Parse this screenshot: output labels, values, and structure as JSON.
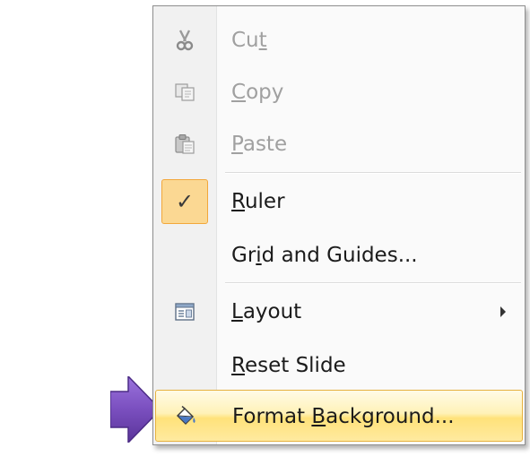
{
  "context_menu": {
    "items": [
      {
        "id": "cut",
        "parts": [
          "Cu",
          "t",
          ""
        ],
        "enabled": false,
        "icon": "scissors-icon"
      },
      {
        "id": "copy",
        "parts": [
          "",
          "C",
          "opy"
        ],
        "enabled": false,
        "icon": "copy-icon"
      },
      {
        "id": "paste",
        "parts": [
          "",
          "P",
          "aste"
        ],
        "enabled": false,
        "icon": "paste-icon"
      },
      {
        "id": "ruler",
        "parts": [
          "",
          "R",
          "uler"
        ],
        "enabled": true,
        "checked": true,
        "icon": "checkmark-icon",
        "check_glyph": "✓"
      },
      {
        "id": "grid-and-guides",
        "parts": [
          "Gr",
          "i",
          "d and Guides..."
        ],
        "enabled": true
      },
      {
        "id": "layout",
        "parts": [
          "",
          "L",
          "ayout"
        ],
        "enabled": true,
        "icon": "layout-icon",
        "has_submenu": true
      },
      {
        "id": "reset-slide",
        "parts": [
          "",
          "R",
          "eset Slide"
        ],
        "enabled": true
      },
      {
        "id": "format-background",
        "parts": [
          "Format ",
          "B",
          "ackground..."
        ],
        "enabled": true,
        "highlighted": true,
        "icon": "paint-bucket-icon"
      }
    ]
  },
  "annotation": {
    "arrow_color": "#7a4fbf",
    "icon": "purple-arrow-icon"
  },
  "colors": {
    "highlight_border": "#e6b13f",
    "highlight_fill": "#ffe27a",
    "check_fill": "#fbd893",
    "disabled_text": "#a0a0a0",
    "menu_text": "#1b1b1b"
  }
}
